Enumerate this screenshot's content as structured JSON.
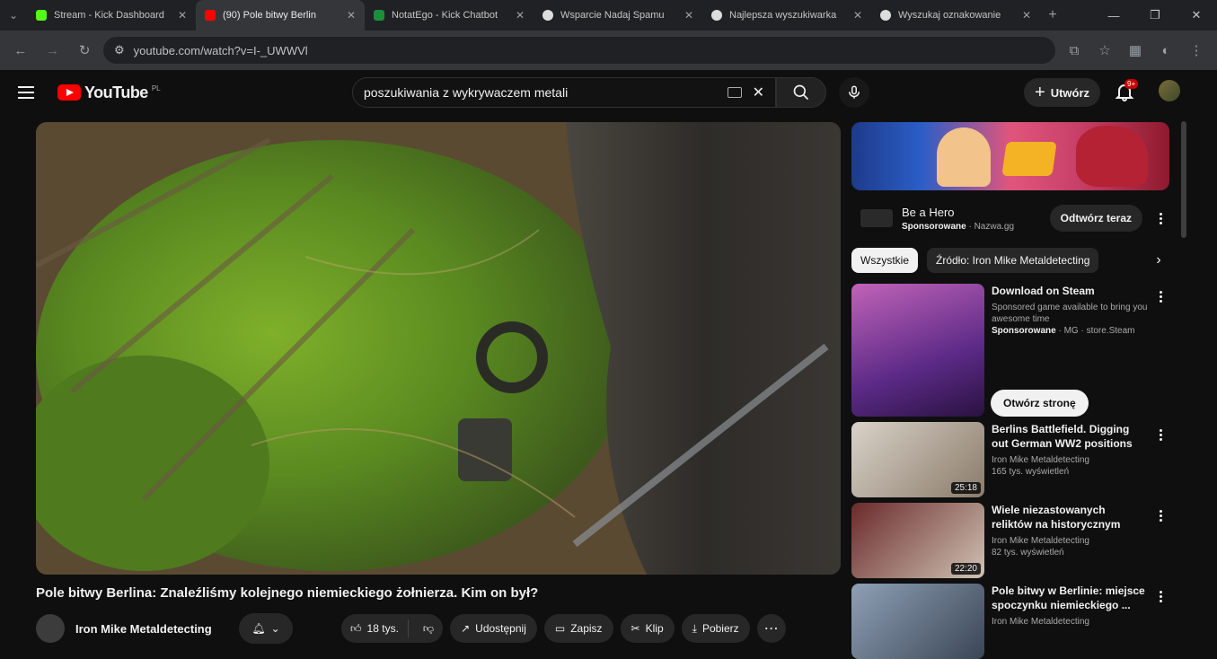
{
  "browser": {
    "tabs": [
      {
        "title": "Stream - Kick Dashboard",
        "color": "#53fc18",
        "active": false
      },
      {
        "title": "(90) Pole bitwy Berlin",
        "color": "#ff0000",
        "active": true
      },
      {
        "title": "NotatEgo - Kick Chatbot",
        "color": "#1a8f3a",
        "active": false
      },
      {
        "title": "Wsparcie Nadaj Spamu",
        "color": "#dddddd",
        "active": false
      },
      {
        "title": "Najlepsza wyszukiwarka",
        "color": "#dddddd",
        "active": false
      },
      {
        "title": "Wyszukaj oznakowanie",
        "color": "#dddddd",
        "active": false
      }
    ],
    "url": "youtube.com/watch?v=I-_UWWVl",
    "window_controls": [
      "—",
      "❐",
      "✕"
    ]
  },
  "header": {
    "logo_text": "YouTube",
    "logo_country": "PL",
    "search_value": "poszukiwania z wykrywaczem metali",
    "create_label": "Utwórz",
    "notification_count": "9+"
  },
  "video": {
    "title": "Pole bitwy Berlina: Znaleźliśmy kolejnego niemieckiego żołnierza. Kim on był?",
    "channel": "Iron Mike Metaldetecting",
    "likes": "18 tys.",
    "share_label": "Udostępnij",
    "save_label": "Zapisz",
    "clip_label": "Klip",
    "download_label": "Pobierz"
  },
  "ad": {
    "title": "Be a Hero",
    "sponsored": "Sponsorowane",
    "domain": "Nazwa.gg",
    "button_label": "Odtwórz teraz"
  },
  "chips": [
    "Wszystkie",
    "Źródło: Iron Mike Metaldetecting"
  ],
  "recommendations": [
    {
      "title": "Download on Steam",
      "line1": "Sponsored game available to bring you",
      "line2": "awesome time",
      "sponsored": "Sponsorowane",
      "meta": "MG · store.Steam",
      "button": "Otwórz stronę",
      "duration": "",
      "colors": [
        "#5b2a86",
        "#c063b8"
      ]
    },
    {
      "title": "Berlins Battlefield. Digging out German WW2 positions",
      "line1": "Iron Mike Metaldetecting",
      "line2": "165 tys. wyświetleń",
      "sponsored": "",
      "meta": "",
      "button": "",
      "duration": "25:18",
      "colors": [
        "#d9d2c8",
        "#8a7b6a"
      ]
    },
    {
      "title": "Wiele niezastowanych reliktów na historycznym wysypisku śmie...",
      "line1": "Iron Mike Metaldetecting",
      "line2": "82 tys. wyświetleń",
      "sponsored": "",
      "meta": "",
      "button": "",
      "duration": "22:20",
      "colors": [
        "#6b2a2a",
        "#cfc3b3"
      ]
    },
    {
      "title": "Pole bitwy w Berlinie: miejsce spoczynku niemieckiego ...",
      "line1": "Iron Mike Metaldetecting",
      "line2": "",
      "sponsored": "",
      "meta": "",
      "button": "",
      "duration": "",
      "colors": [
        "#8fa0b5",
        "#3a4656"
      ]
    }
  ]
}
